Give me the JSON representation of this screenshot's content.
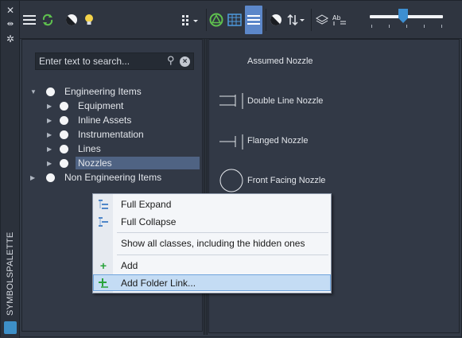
{
  "palette_title": "SYMBOLSPALETTE",
  "search": {
    "placeholder": "Enter text to search..."
  },
  "tree": {
    "root1": "Engineering Items",
    "children": [
      "Equipment",
      "Inline Assets",
      "Instrumentation",
      "Lines",
      "Nozzles"
    ],
    "root2": "Non Engineering Items",
    "selected": "Nozzles"
  },
  "symbols": [
    "Assumed Nozzle",
    "Double Line Nozzle",
    "Flanged Nozzle",
    "Front Facing Nozzle"
  ],
  "context_menu": {
    "items": [
      "Full Expand",
      "Full Collapse",
      "Show all classes, including the hidden ones",
      "Add",
      "Add Folder Link..."
    ],
    "highlighted": "Add Folder Link..."
  },
  "toolbar": {
    "icons": [
      "menu-icon",
      "refresh-icon",
      "contrast-icon",
      "bulb-icon",
      "grid-dropdown-icon",
      "triangle-circle-icon",
      "table-view-icon",
      "list-view-icon",
      "contrast-icon",
      "sort-icon",
      "layers-icon",
      "text-list-icon"
    ]
  },
  "colors": {
    "accent": "#5c87c9",
    "selection": "#4f6383",
    "menu_highlight": "#c4dcf4"
  }
}
